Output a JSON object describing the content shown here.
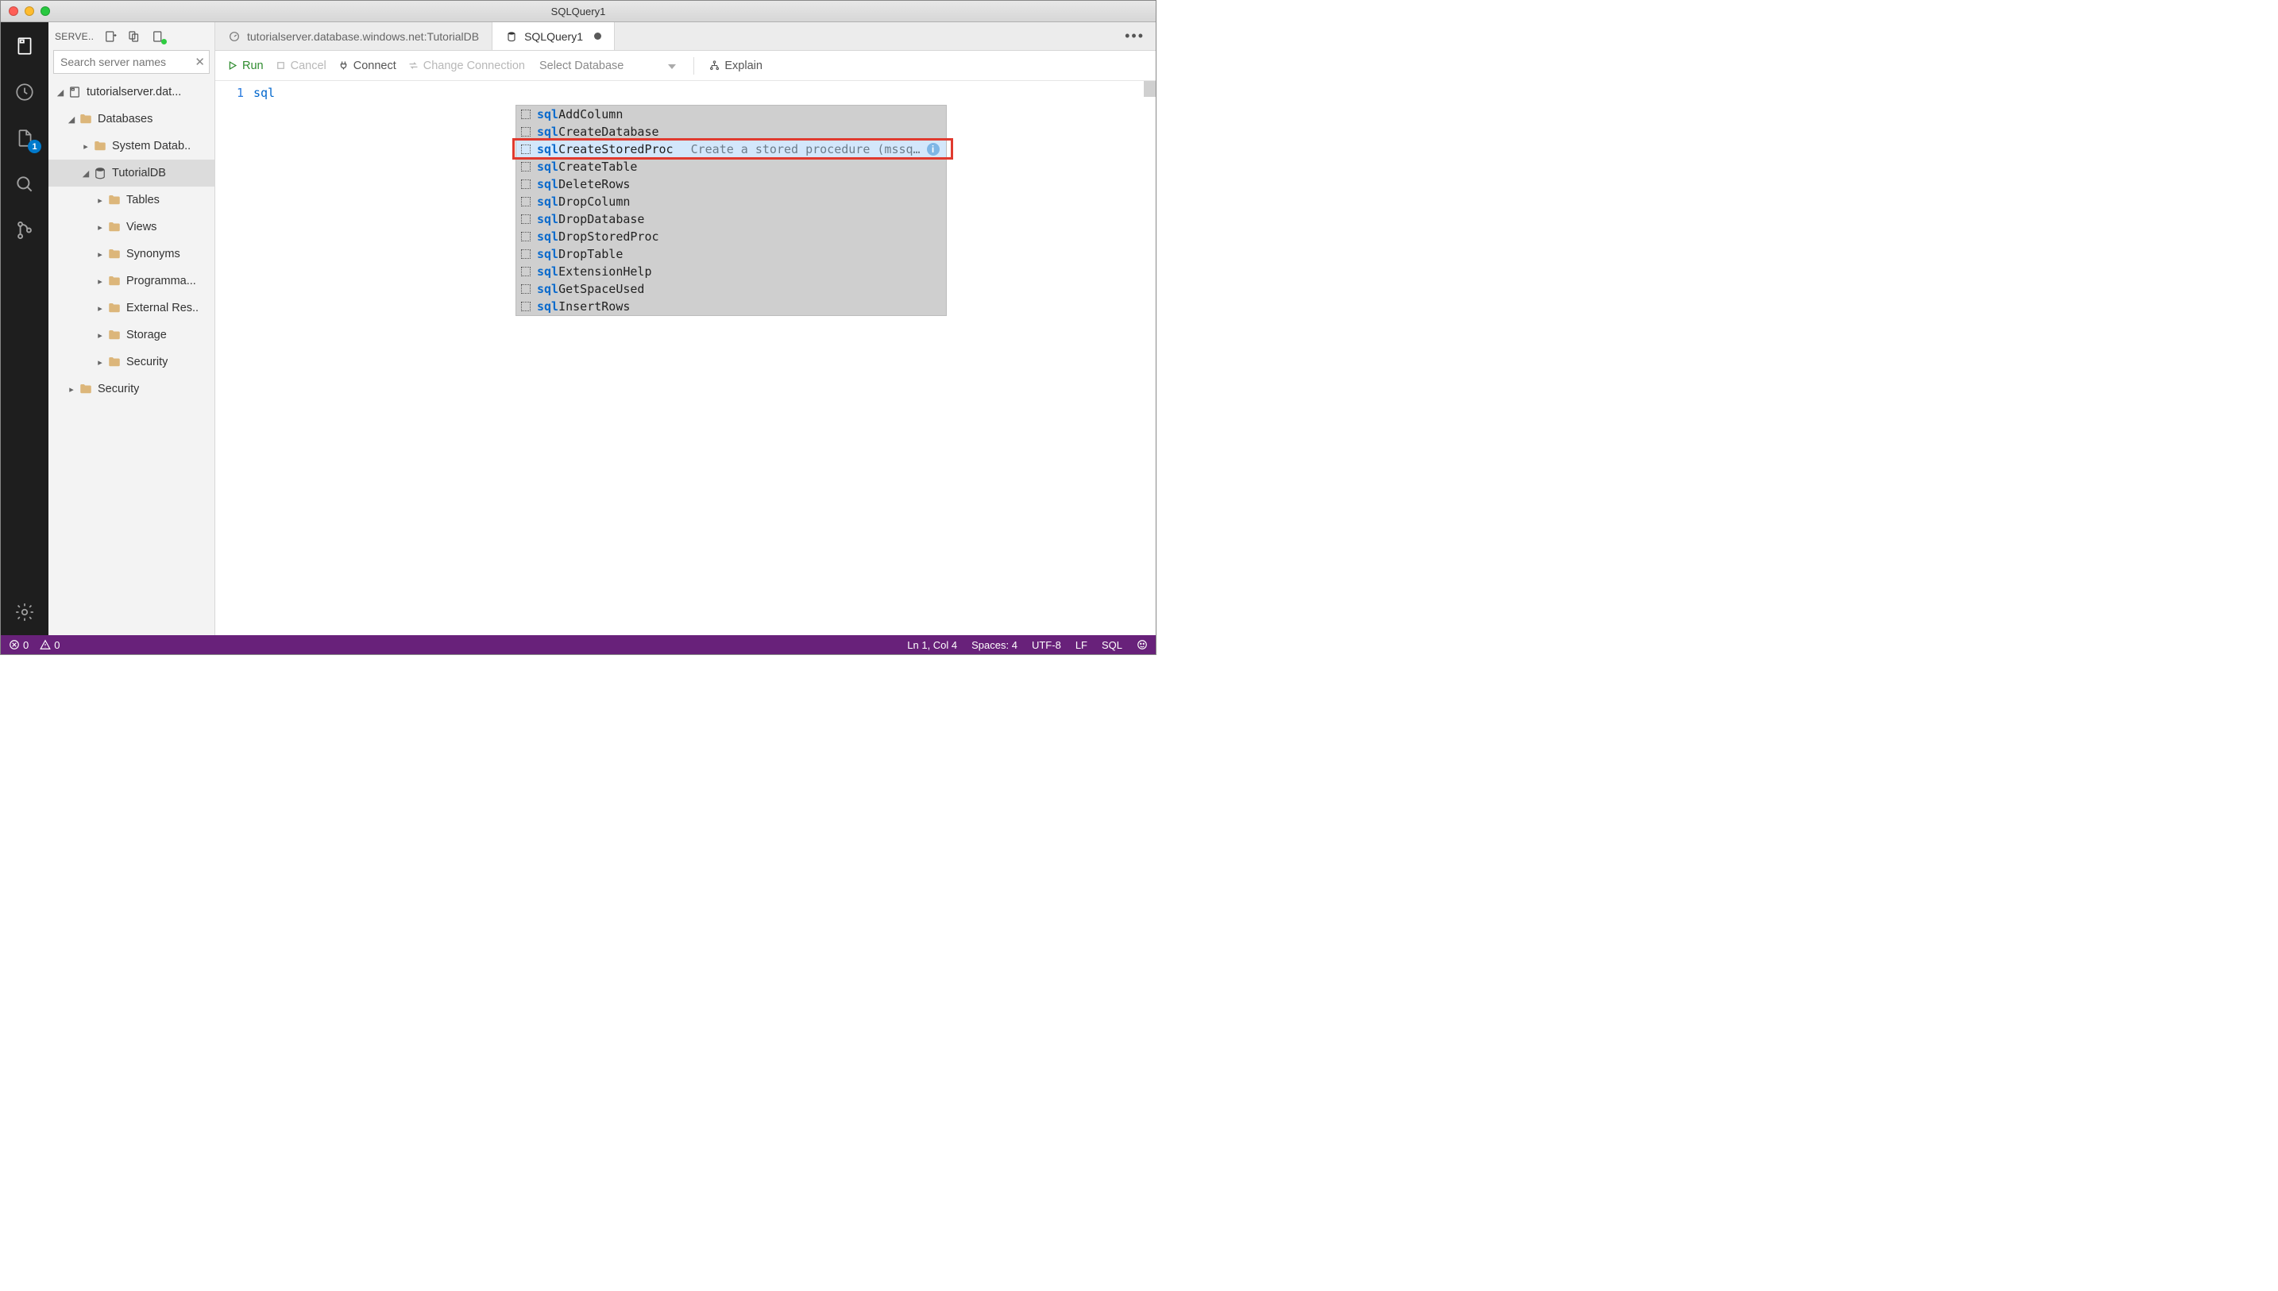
{
  "title": "SQLQuery1",
  "activity": {
    "badge_files": "1"
  },
  "sidebar": {
    "header": "SERVE..",
    "search_placeholder": "Search server names",
    "tree": {
      "server": "tutorialserver.dat...",
      "databases": "Databases",
      "sysdb": "System Datab..",
      "tutorialdb": "TutorialDB",
      "tables": "Tables",
      "views": "Views",
      "synonyms": "Synonyms",
      "programma": "Programma...",
      "extres": "External Res..",
      "storage": "Storage",
      "security_inner": "Security",
      "security": "Security"
    }
  },
  "tabs": {
    "t0": "tutorialserver.database.windows.net:TutorialDB",
    "t1": "SQLQuery1"
  },
  "toolbar": {
    "run": "Run",
    "cancel": "Cancel",
    "connect": "Connect",
    "change": "Change Connection",
    "select_db": "Select Database",
    "explain": "Explain"
  },
  "editor": {
    "line_no": "1",
    "typed": "sql"
  },
  "suggest": {
    "match": "sql",
    "items": [
      {
        "rest": "AddColumn"
      },
      {
        "rest": "CreateDatabase"
      },
      {
        "rest": "CreateStoredProc",
        "hint": "Create a stored procedure (mssq…",
        "selected": true,
        "info": true
      },
      {
        "rest": "CreateTable"
      },
      {
        "rest": "DeleteRows"
      },
      {
        "rest": "DropColumn"
      },
      {
        "rest": "DropDatabase"
      },
      {
        "rest": "DropStoredProc"
      },
      {
        "rest": "DropTable"
      },
      {
        "rest": "ExtensionHelp"
      },
      {
        "rest": "GetSpaceUsed"
      },
      {
        "rest": "InsertRows"
      }
    ]
  },
  "status": {
    "errors": "0",
    "warnings": "0",
    "ln_col": "Ln 1, Col 4",
    "spaces": "Spaces: 4",
    "encoding": "UTF-8",
    "eol": "LF",
    "lang": "SQL"
  }
}
